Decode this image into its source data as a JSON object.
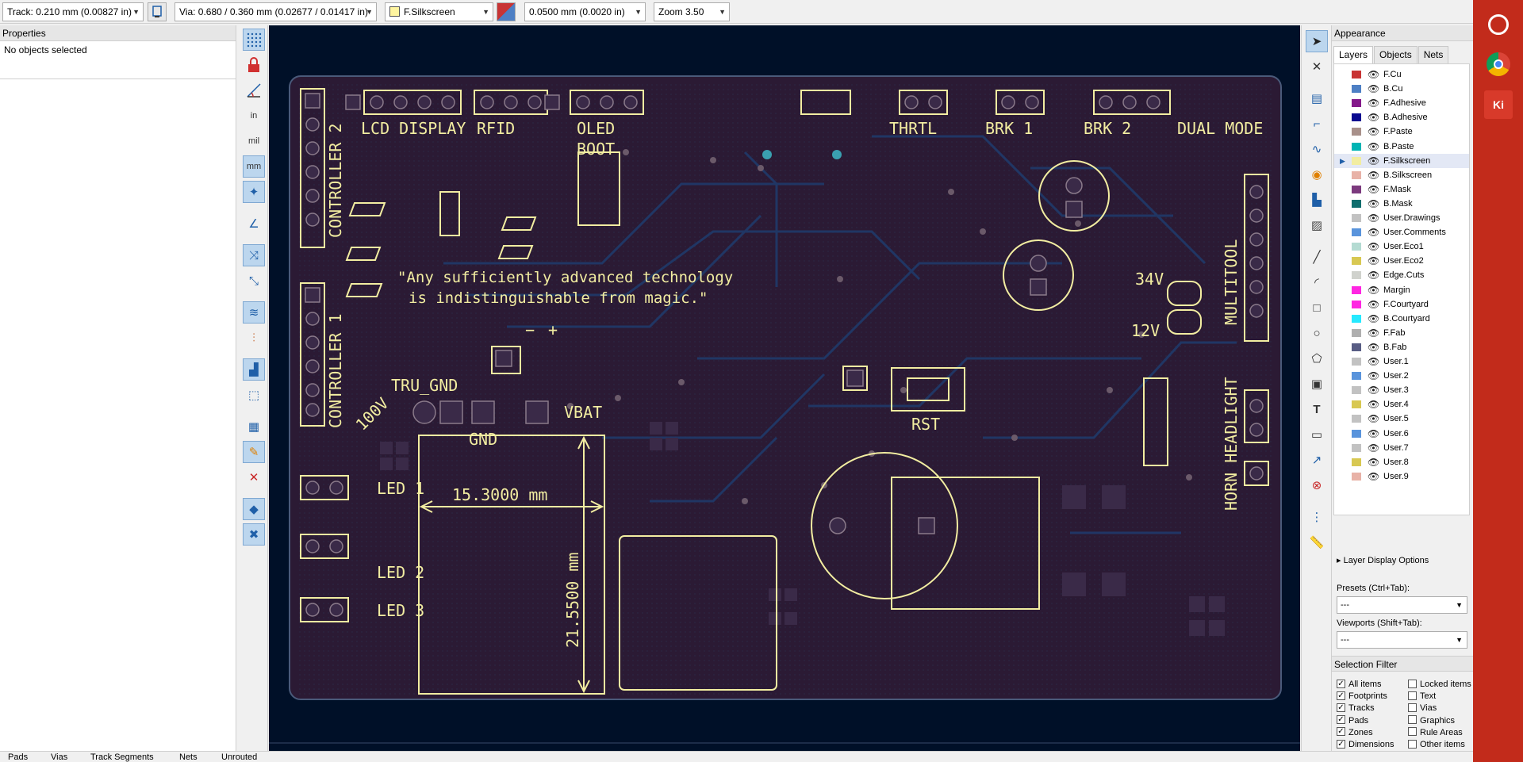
{
  "toolbar": {
    "track": "Track: 0.210 mm (0.00827 in)",
    "via": "Via: 0.680 / 0.360 mm (0.02677 / 0.01417 in)",
    "layer": "F.Silkscreen",
    "layer_color": "#fff5a0",
    "grid": "0.0500 mm (0.0020 in)",
    "zoom": "Zoom 3.50"
  },
  "properties": {
    "title": "Properties",
    "status": "No objects selected"
  },
  "canvas": {
    "quote_line1": "\"Any sufficiently advanced technology",
    "quote_line2": "is indistinguishable from magic.\"",
    "labels": {
      "lcd": "LCD DISPLAY",
      "rfid": "RFID",
      "oled": "OLED",
      "boot": "BOOT",
      "thrtl": "THRTL",
      "brk1": "BRK 1",
      "brk2": "BRK 2",
      "dual": "DUAL MODE",
      "controller2": "CONTROLLER 2",
      "controller1": "CONTROLLER 1",
      "multitool": "MULTITOOL",
      "horn": "HORN HEADLIGHT",
      "v34": "34V",
      "v12": "12V",
      "tru_gnd": "TRU_GND",
      "v100": "100V",
      "gnd": "GND",
      "vbat": "VBAT",
      "led1": "LED 1",
      "led2": "LED 2",
      "led3": "LED 3",
      "rst": "RST",
      "minus": "−",
      "plus": "+",
      "dim_h": "15.3000 mm",
      "dim_v": "21.5500 mm"
    }
  },
  "appearance": {
    "title": "Appearance",
    "tabs": [
      "Layers",
      "Objects",
      "Nets"
    ],
    "layers": [
      {
        "name": "F.Cu",
        "color": "#c83434"
      },
      {
        "name": "B.Cu",
        "color": "#4d7fc4"
      },
      {
        "name": "F.Adhesive",
        "color": "#84198a"
      },
      {
        "name": "B.Adhesive",
        "color": "#0a0a90"
      },
      {
        "name": "F.Paste",
        "color": "#a8908a"
      },
      {
        "name": "B.Paste",
        "color": "#00b4b4"
      },
      {
        "name": "F.Silkscreen",
        "color": "#f2eda1"
      },
      {
        "name": "B.Silkscreen",
        "color": "#e8b2a7"
      },
      {
        "name": "F.Mask",
        "color": "#7c3a7e"
      },
      {
        "name": "B.Mask",
        "color": "#106e6e"
      },
      {
        "name": "User.Drawings",
        "color": "#c2c2c2"
      },
      {
        "name": "User.Comments",
        "color": "#5994dc"
      },
      {
        "name": "User.Eco1",
        "color": "#b4dbd2"
      },
      {
        "name": "User.Eco2",
        "color": "#d8c852"
      },
      {
        "name": "Edge.Cuts",
        "color": "#d0d2cd"
      },
      {
        "name": "Margin",
        "color": "#ff26e2"
      },
      {
        "name": "F.Courtyard",
        "color": "#ff26e2"
      },
      {
        "name": "B.Courtyard",
        "color": "#26e9ff"
      },
      {
        "name": "F.Fab",
        "color": "#afafaf"
      },
      {
        "name": "B.Fab",
        "color": "#585d84"
      },
      {
        "name": "User.1",
        "color": "#c2c2c2"
      },
      {
        "name": "User.2",
        "color": "#5994dc"
      },
      {
        "name": "User.3",
        "color": "#c2c2c2"
      },
      {
        "name": "User.4",
        "color": "#d8c852"
      },
      {
        "name": "User.5",
        "color": "#c2c2c2"
      },
      {
        "name": "User.6",
        "color": "#5994dc"
      },
      {
        "name": "User.7",
        "color": "#c2c2c2"
      },
      {
        "name": "User.8",
        "color": "#d8c852"
      },
      {
        "name": "User.9",
        "color": "#e8b2a7"
      }
    ],
    "layer_display_options": "Layer Display Options",
    "presets_label": "Presets (Ctrl+Tab):",
    "presets_value": "---",
    "viewports_label": "Viewports (Shift+Tab):",
    "viewports_value": "---",
    "selection_filter": "Selection Filter",
    "filters_left": [
      "All items",
      "Footprints",
      "Tracks",
      "Pads",
      "Zones",
      "Dimensions"
    ],
    "filters_right": [
      "Locked items",
      "Text",
      "Vias",
      "Graphics",
      "Rule Areas",
      "Other items"
    ]
  },
  "statusbar": {
    "pads": "Pads",
    "vias": "Vias",
    "track_segments": "Track Segments",
    "nets": "Nets",
    "unrouted": "Unrouted"
  },
  "taskbar": {
    "kicad": "Ki"
  }
}
